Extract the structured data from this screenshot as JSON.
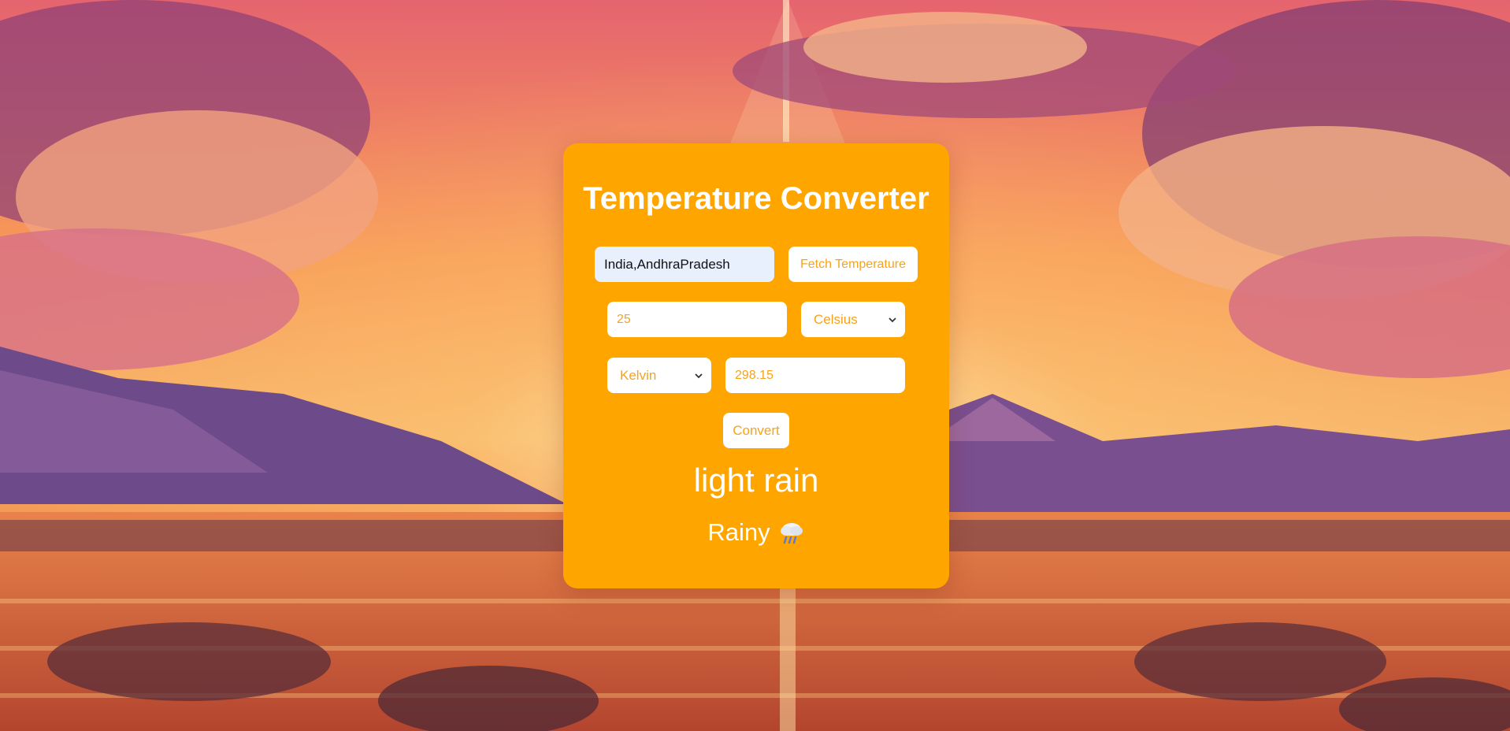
{
  "app": {
    "title": "Temperature Converter"
  },
  "location": {
    "value": "India,AndhraPradesh"
  },
  "fetch": {
    "label": "Fetch Temperature"
  },
  "converter": {
    "input_value": "25",
    "from_unit": "Celsius",
    "to_unit": "Kelvin",
    "output_value": "298.15",
    "convert_label": "Convert"
  },
  "weather": {
    "description": "light rain",
    "condition": "Rainy",
    "condition_icon": "cloud-rain-icon"
  },
  "colors": {
    "card": "#ffa500",
    "accent_text": "#f5a31d"
  }
}
